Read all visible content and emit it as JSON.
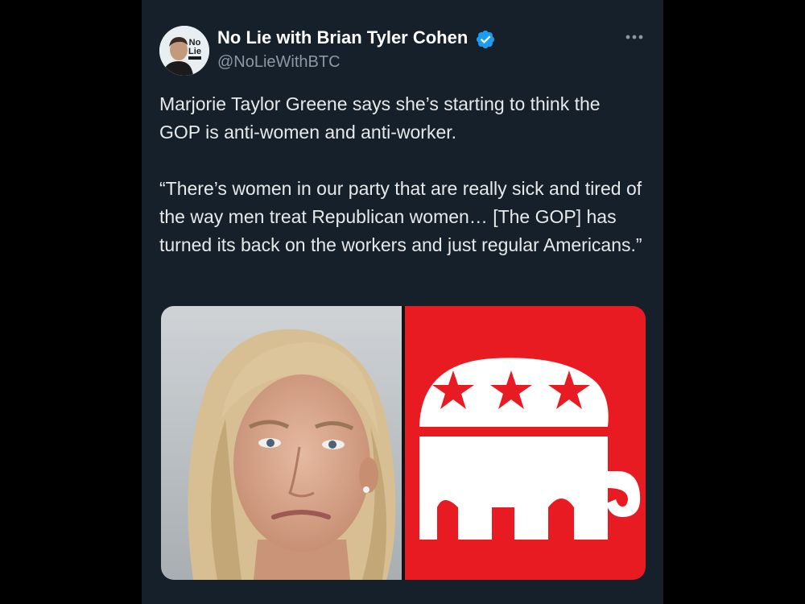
{
  "tweet": {
    "author_name": "No Lie with Brian Tyler Cohen",
    "handle": "@NoLieWithBTC",
    "verified": true,
    "avatar_text": "No Lie",
    "more_icon": "more-horizontal-icon",
    "text_paragraphs": [
      "Marjorie Taylor Greene says she’s starting to think the GOP is anti-women and anti-worker.",
      "“There’s women in our party that are really sick and tired of the way men treat Republican women… [The GOP] has turned its back on the workers and just regular Americans.”"
    ],
    "media": {
      "count": 2,
      "items": [
        "photo of woman",
        "Republican elephant logo"
      ]
    }
  },
  "colors": {
    "background": "#15202b",
    "name": "#ffffff",
    "text": "#e7e9ea",
    "secondary": "#8b98a5",
    "verified": "#1d9bf0",
    "gop_red": "#e81b23"
  }
}
